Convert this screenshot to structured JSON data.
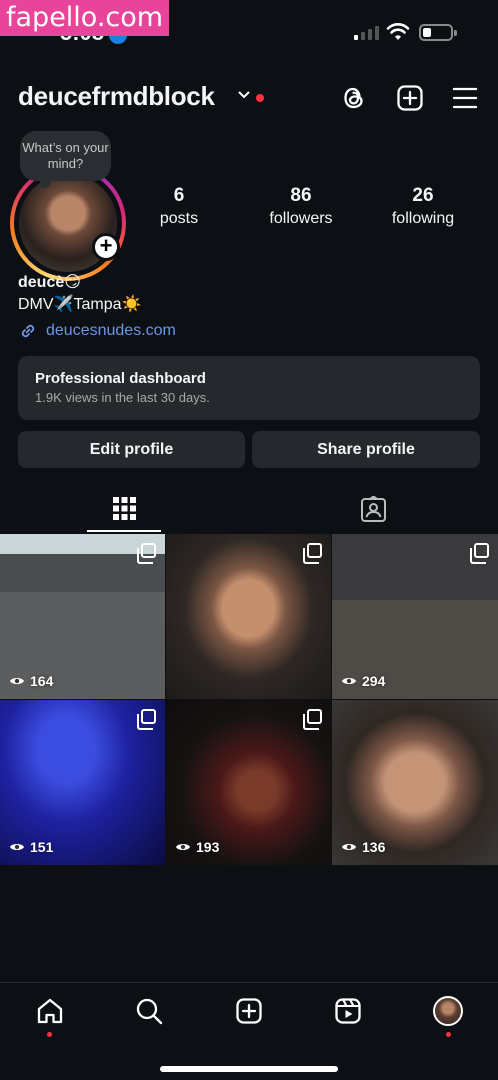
{
  "watermark": "fapello.com",
  "status_bar": {
    "time": "5:08",
    "signal_bars": 1,
    "wifi": "wifi-icon",
    "battery_level": 0.25
  },
  "header": {
    "username": "deucefrmdblock",
    "icons": [
      "threads-icon",
      "create-icon",
      "menu-icon"
    ],
    "notification_color": "#ff3040"
  },
  "profile": {
    "note": "What’s on your mind?",
    "stats": [
      {
        "value": "6",
        "label": "posts"
      },
      {
        "value": "86",
        "label": "followers"
      },
      {
        "value": "26",
        "label": "following"
      }
    ],
    "name": "deucè😏",
    "bio_line": "DMV✈️Tampa☀️",
    "link": "deucesnudes.com"
  },
  "dashboard": {
    "title": "Professional dashboard",
    "subtitle": "1.9K views in the last 30 days."
  },
  "buttons": {
    "edit": "Edit profile",
    "share": "Share profile"
  },
  "tabs": [
    "grid-icon",
    "tagged-icon"
  ],
  "posts": [
    {
      "views": "164",
      "carousel": true
    },
    {
      "views": "",
      "carousel": true
    },
    {
      "views": "294",
      "carousel": true
    },
    {
      "views": "151",
      "carousel": true
    },
    {
      "views": "193",
      "carousel": true
    },
    {
      "views": "136",
      "carousel": false
    }
  ],
  "bottom_nav": [
    "home-icon",
    "search-icon",
    "create-icon",
    "reels-icon",
    "profile-avatar"
  ],
  "colors": {
    "background": "#0c1014",
    "surface": "#25292e",
    "link": "#6c95e6",
    "accent": "#ff3040"
  }
}
